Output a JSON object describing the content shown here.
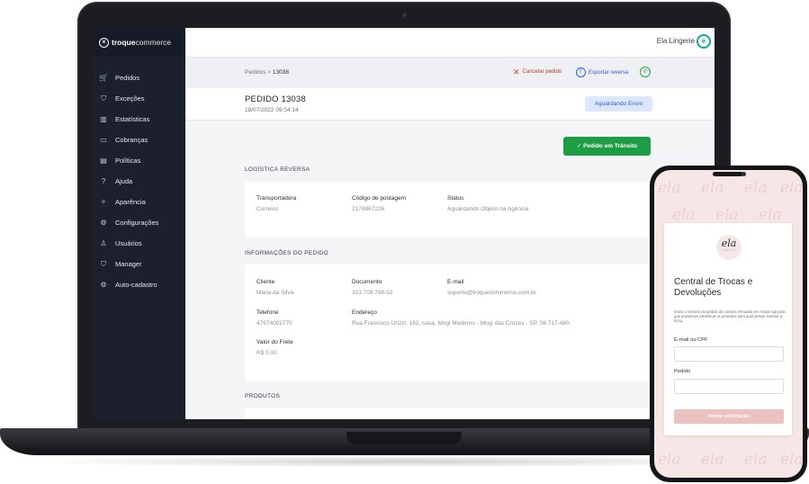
{
  "brand": {
    "mark": "e",
    "name_bold": "troque",
    "name_light": "commerce"
  },
  "store": {
    "name": "Ela Lingerie",
    "logo": "e"
  },
  "nav": {
    "items": [
      {
        "label": "Pedidos",
        "icon": "🛒"
      },
      {
        "label": "Exceções",
        "icon": "⛉"
      },
      {
        "label": "Estatísticas",
        "icon": "▥"
      },
      {
        "label": "Cobranças",
        "icon": "▭"
      },
      {
        "label": "Políticas",
        "icon": "▤"
      },
      {
        "label": "Ajuda",
        "icon": "?"
      },
      {
        "label": "Aparência",
        "icon": "✧"
      },
      {
        "label": "Configurações",
        "icon": "⚙"
      },
      {
        "label": "Usuários",
        "icon": "♙"
      },
      {
        "label": "Manager",
        "icon": "⛉"
      },
      {
        "label": "Auto-cadastro",
        "icon": "⚙"
      }
    ]
  },
  "breadcrumb": {
    "parent": "Pedidos > ",
    "current": "13038"
  },
  "actions": {
    "cancel_icon": "✕",
    "cancel": "Cancelar pedido",
    "export_icon": "⇧",
    "export": "Exportar reversa",
    "whatsapp_icon": "✆"
  },
  "order": {
    "title": "PEDIDO 13038",
    "date": "18/07/2022 09:54:14",
    "status": "Aguardando Envio",
    "transit_button": "✓  Pedido em Trânsito"
  },
  "logistics": {
    "title": "LOGÍSTICA REVERSA",
    "fields": [
      {
        "label": "Transportadora",
        "value": "Correios"
      },
      {
        "label": "Código de postagem",
        "value": "2178867226"
      },
      {
        "label": "Status",
        "value": "Aguardando Objeto na Agência"
      }
    ]
  },
  "info": {
    "title": "INFORMAÇÕES DO PEDIDO",
    "cliente": {
      "label": "Cliente",
      "value": "Maria da Silva"
    },
    "documento": {
      "label": "Documento",
      "value": "323.709.798-52"
    },
    "email": {
      "label": "E-mail",
      "value": "suporte@troquecommerce.com.br"
    },
    "telefone": {
      "label": "Telefone",
      "value": "47974002770"
    },
    "endereco": {
      "label": "Endereço",
      "value": "Rua Francisco Urizzi, 162, casa, Mogi Moderno - Mogi das Cruzes - SP, 08.717-460."
    },
    "frete": {
      "label": "Valor do Frete",
      "value": "R$ 0,00"
    }
  },
  "products": {
    "title": "PRODUTOS"
  },
  "phone": {
    "pattern_word": "ela",
    "logo_word": "ela",
    "logo_sub": "lingerie",
    "title": "Central de Trocas e Devoluções",
    "description": "Insira o número do pedido da compra efetuada em nossa loja para que possamos identificar os produtos para qual deseja solicitar a troca.",
    "email_label": "E-mail ou CPF",
    "order_label": "Pedido",
    "submit": "Iniciar solicitação"
  }
}
